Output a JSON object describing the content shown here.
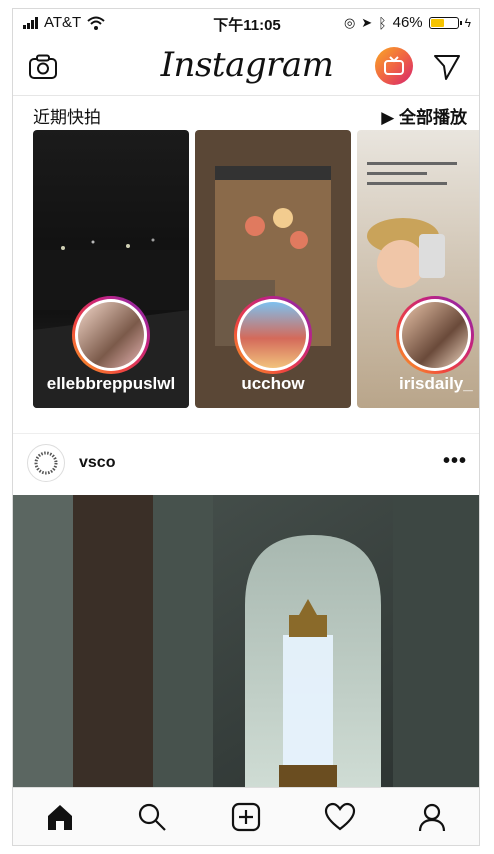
{
  "status": {
    "carrier": "AT&T",
    "time": "下午11:05",
    "battery": "46%",
    "battery_level": 0.46
  },
  "header": {
    "logo_text": "Instagram",
    "camera_icon": "camera-icon",
    "igtv_icon": "igtv-icon",
    "direct_icon": "paper-plane-icon"
  },
  "stories": {
    "title": "近期快拍",
    "watch_all": "▶ 全部播放",
    "items": [
      {
        "username": "ellebbreppuslwl"
      },
      {
        "username": "ucchow"
      },
      {
        "username": "irisdaily_"
      }
    ]
  },
  "post": {
    "username": "vsco",
    "more_label": "•••"
  },
  "tabbar": {
    "items": [
      "home-icon",
      "search-icon",
      "add-icon",
      "heart-icon",
      "profile-icon"
    ]
  },
  "colors": {
    "accent_gradient_start": "#f9a825",
    "accent_gradient_end": "#7b2bb6",
    "battery": "#f6c400"
  }
}
